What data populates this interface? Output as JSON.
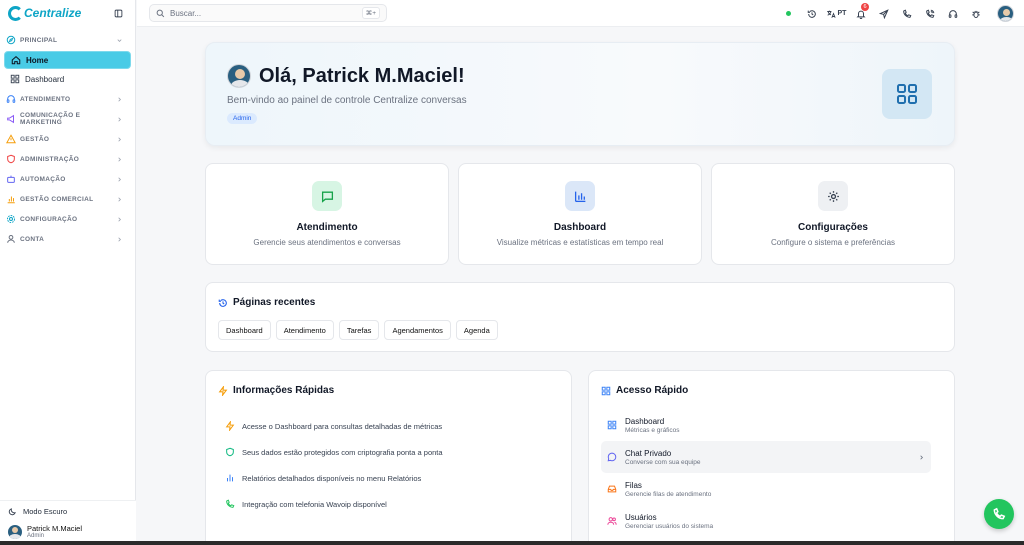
{
  "brand": {
    "name": "Centralize",
    "color": "#0ea5c6"
  },
  "sidebar": {
    "sections": [
      {
        "label": "PRINCIPAL",
        "icon": "compass-icon",
        "items": [
          {
            "label": "Home",
            "icon": "home-icon",
            "active": true
          },
          {
            "label": "Dashboard",
            "icon": "grid-icon",
            "active": false
          }
        ]
      },
      {
        "label": "ATENDIMENTO",
        "icon": "headset-icon"
      },
      {
        "label": "COMUNICAÇÃO E MARKETING",
        "icon": "megaphone-icon"
      },
      {
        "label": "GESTÃO",
        "icon": "warning-icon"
      },
      {
        "label": "ADMINISTRAÇÃO",
        "icon": "shield-icon"
      },
      {
        "label": "AUTOMAÇÃO",
        "icon": "bot-icon"
      },
      {
        "label": "GESTÃO COMERCIAL",
        "icon": "bar-chart-icon"
      },
      {
        "label": "CONFIGURAÇÃO",
        "icon": "gear-icon"
      },
      {
        "label": "CONTA",
        "icon": "user-icon"
      }
    ],
    "dark_mode_label": "Modo Escuro",
    "user": {
      "name": "Patrick M.Maciel",
      "role": "Admin"
    }
  },
  "topbar": {
    "search_placeholder": "Buscar...",
    "shortcut": "⌘+",
    "language": "PT",
    "notification_count": "6"
  },
  "hero": {
    "greeting": "Olá, Patrick M.Maciel!",
    "subtitle": "Bem-vindo ao painel de controle Centralize conversas",
    "role": "Admin"
  },
  "cards": [
    {
      "title": "Atendimento",
      "desc": "Gerencie seus atendimentos e conversas",
      "icon": "message-square-icon",
      "bg": "#d7f5e4",
      "fg": "#16a34a"
    },
    {
      "title": "Dashboard",
      "desc": "Visualize métricas e estatísticas em tempo real",
      "icon": "bar-chart-icon",
      "bg": "#dbe7f8",
      "fg": "#2563eb"
    },
    {
      "title": "Configurações",
      "desc": "Configure o sistema e preferências",
      "icon": "gear-icon",
      "bg": "#eef0f3",
      "fg": "#374151"
    }
  ],
  "recent": {
    "title": "Páginas recentes",
    "pages": [
      "Dashboard",
      "Atendimento",
      "Tarefas",
      "Agendamentos",
      "Agenda"
    ]
  },
  "info": {
    "title": "Informações Rápidas",
    "items": [
      {
        "text": "Acesse o Dashboard para consultas detalhadas de métricas",
        "icon": "zap-icon",
        "color": "#f59e0b"
      },
      {
        "text": "Seus dados estão protegidos com criptografia ponta a ponta",
        "icon": "shield-icon",
        "color": "#10b981"
      },
      {
        "text": "Relatórios detalhados disponíveis no menu Relatórios",
        "icon": "bar-chart-icon",
        "color": "#3b82f6"
      },
      {
        "text": "Integração com telefonia Wavoip disponível",
        "icon": "phone-icon",
        "color": "#22c55e"
      }
    ]
  },
  "quick": {
    "title": "Acesso Rápido",
    "items": [
      {
        "title": "Dashboard",
        "sub": "Métricas e gráficos",
        "icon": "grid-icon",
        "color": "#3b82f6"
      },
      {
        "title": "Chat Privado",
        "sub": "Converse com sua equipe",
        "icon": "message-circle-icon",
        "color": "#6366f1"
      },
      {
        "title": "Filas",
        "sub": "Gerencie filas de atendimento",
        "icon": "inbox-icon",
        "color": "#f97316"
      },
      {
        "title": "Usuários",
        "sub": "Gerenciar usuários do sistema",
        "icon": "users-icon",
        "color": "#ec4899"
      }
    ]
  }
}
